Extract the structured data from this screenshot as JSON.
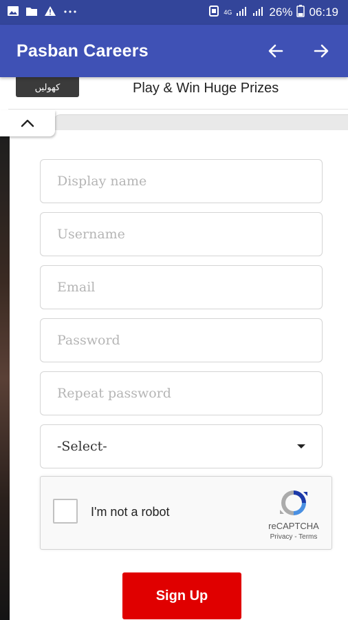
{
  "status_bar": {
    "network": "4G",
    "battery": "26%",
    "time": "06:19",
    "left_icons": [
      "image-icon",
      "folder-icon",
      "alert-icon",
      "more-dots-icon"
    ]
  },
  "app_bar": {
    "title": "Pasban Careers",
    "back_icon": "arrow-left-icon",
    "forward_icon": "arrow-right-icon"
  },
  "ad": {
    "button_label": "کھولیں",
    "text": "Play & Win Huge Prizes",
    "collapse_icon": "chevron-up-icon"
  },
  "form": {
    "display_name": {
      "placeholder": "Display name",
      "value": ""
    },
    "username": {
      "placeholder": "Username",
      "value": ""
    },
    "email": {
      "placeholder": "Email",
      "value": ""
    },
    "password": {
      "placeholder": "Password",
      "value": ""
    },
    "repeat_password": {
      "placeholder": "Repeat password",
      "value": ""
    },
    "select": {
      "selected": "-Select-"
    }
  },
  "captcha": {
    "label": "I'm not a robot",
    "brand": "reCAPTCHA",
    "links": "Privacy - Terms"
  },
  "signup": {
    "label": "Sign Up"
  },
  "colors": {
    "status_bar": "#33459a",
    "app_bar": "#3f51b5",
    "signup": "#e00000"
  }
}
